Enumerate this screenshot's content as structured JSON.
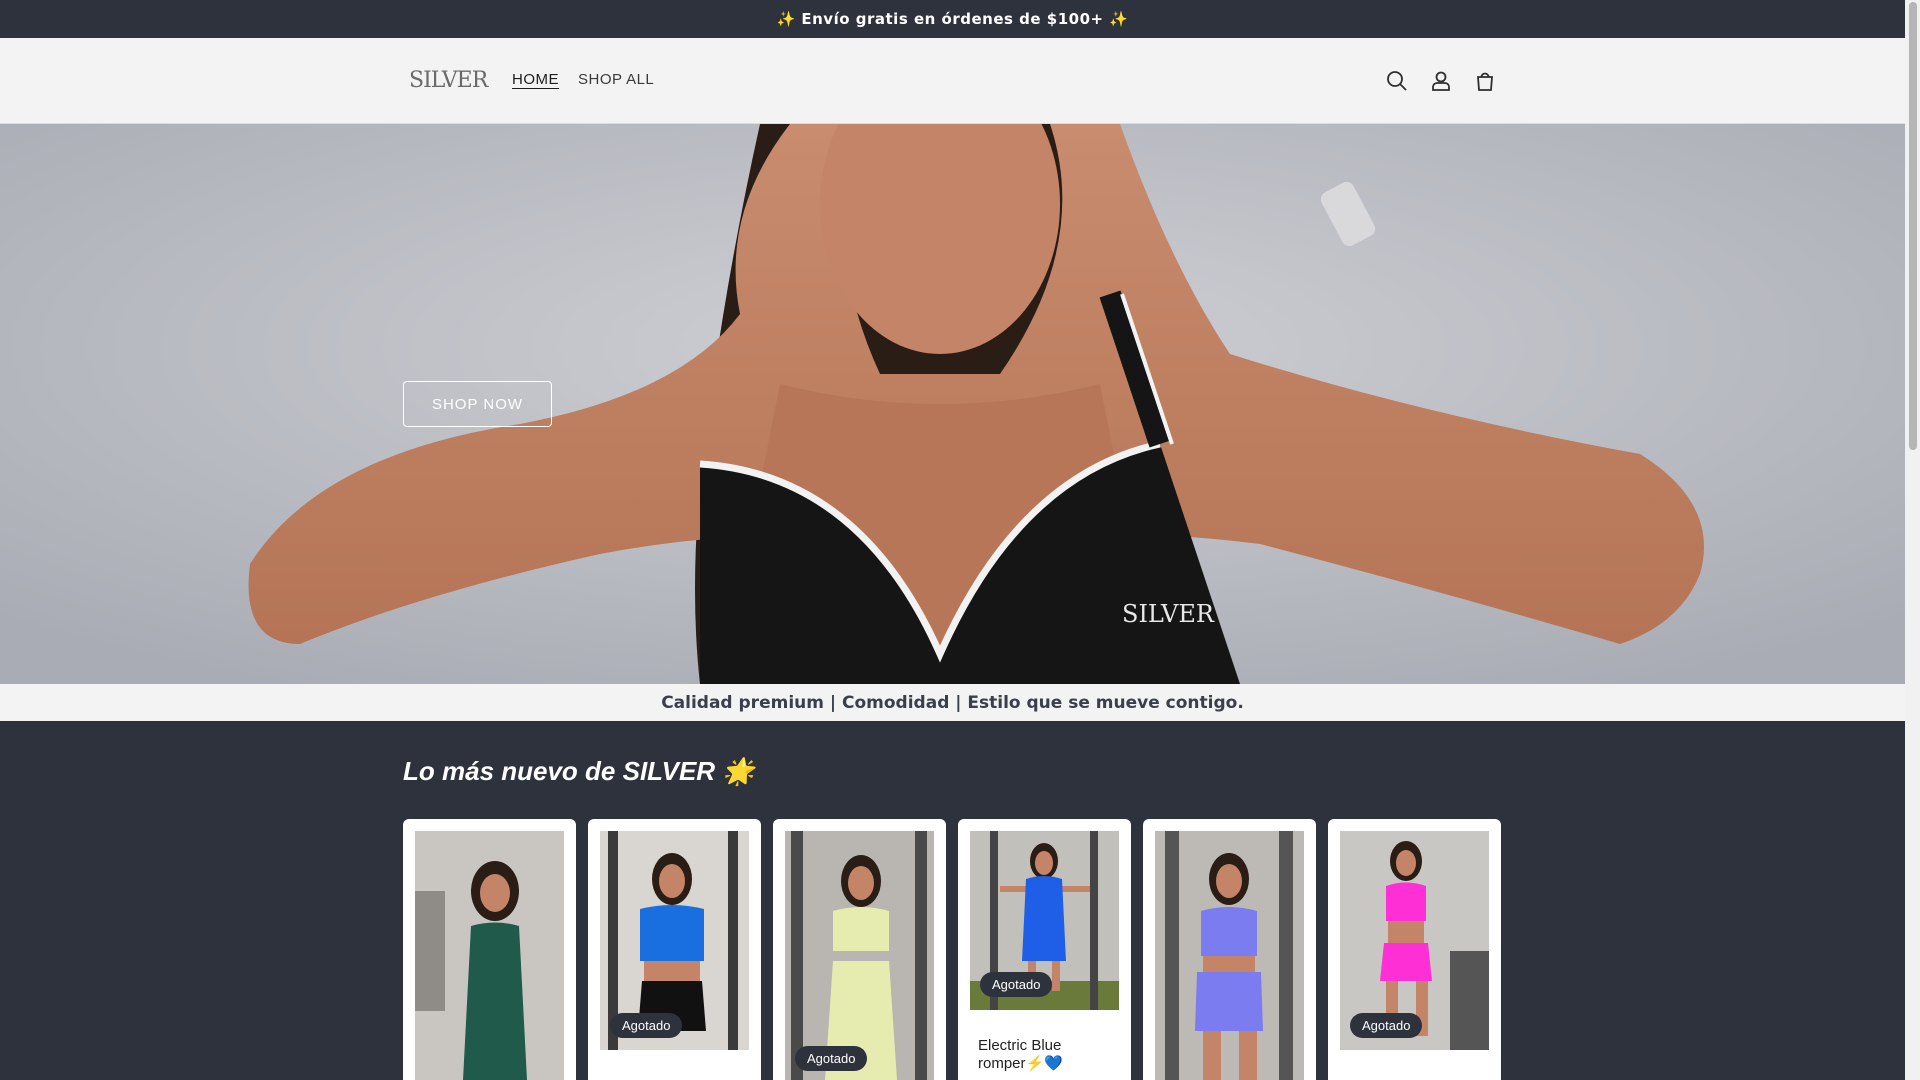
{
  "announcement": {
    "text": "✨ Envío gratis en órdenes de $100+ ✨"
  },
  "header": {
    "logo": "SILVER",
    "nav": [
      {
        "label": "HOME",
        "active": true
      },
      {
        "label": "SHOP ALL",
        "active": false
      }
    ],
    "icons": [
      "search-icon",
      "account-icon",
      "cart-icon"
    ]
  },
  "hero": {
    "cta_label": "SHOP NOW",
    "top_brand": "SILVER"
  },
  "tagline": "Calidad premium | Comodidad | Estilo que se mueve contigo.",
  "collection": {
    "title": "Lo más nuevo de SILVER 🌟",
    "products": [
      {
        "badge": "",
        "title": ""
      },
      {
        "badge": "Agotado",
        "title": ""
      },
      {
        "badge": "Agotado",
        "title": ""
      },
      {
        "badge": "Agotado",
        "title": "Electric Blue romper⚡💙"
      },
      {
        "badge": "",
        "title": ""
      },
      {
        "badge": "Agotado",
        "title": ""
      }
    ]
  },
  "colors": {
    "dark": "#2e323d",
    "header_bg": "#f3f3f3",
    "product_colors": [
      "#1f5a4a",
      "#1a6fe0",
      "#e6ecb0",
      "#1f5fe8",
      "#7a7cf0",
      "#ff2fd6"
    ]
  }
}
